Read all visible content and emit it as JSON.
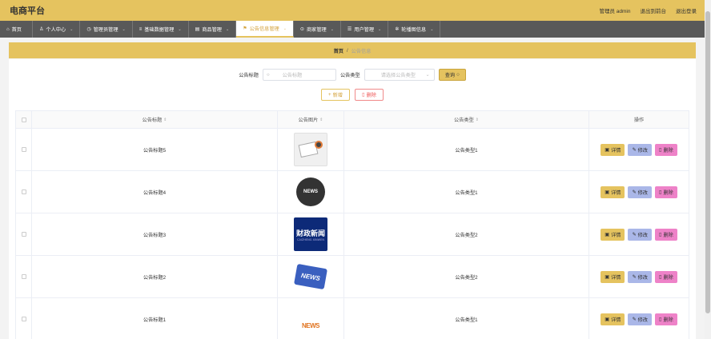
{
  "header": {
    "app_title": "电商平台",
    "user_label": "管理员 admin",
    "front_link": "退出到前台",
    "logout_link": "退出登录"
  },
  "nav": {
    "items": [
      {
        "label": "首页",
        "icon": "home-icon",
        "caret": ""
      },
      {
        "label": "个人中心",
        "icon": "user-icon",
        "caret": "⌄"
      },
      {
        "label": "管理员管理",
        "icon": "clock-icon",
        "caret": "⌄"
      },
      {
        "label": "基础数据管理",
        "icon": "list-icon",
        "caret": "⌄"
      },
      {
        "label": "商品管理",
        "icon": "chart-icon",
        "caret": "⌄"
      },
      {
        "label": "公告信息管理",
        "icon": "flag-icon",
        "caret": "⌄"
      },
      {
        "label": "商家管理",
        "icon": "pin-icon",
        "caret": "⌄"
      },
      {
        "label": "用户管理",
        "icon": "people-icon",
        "caret": "⌄"
      },
      {
        "label": "轮播图信息",
        "icon": "gear-icon",
        "caret": "⌄"
      }
    ],
    "active_index": 5
  },
  "breadcrumb": {
    "home": "首页",
    "sep": "/",
    "current": "公告信息"
  },
  "search": {
    "title_label": "公告标题",
    "title_placeholder": "公告标题",
    "type_label": "公告类型",
    "type_placeholder": "请选择公告类型",
    "query_button": "查询"
  },
  "actions": {
    "add_button": "新增",
    "delete_button": "删除"
  },
  "table": {
    "columns": {
      "title": "公告标题",
      "image": "公告图片",
      "type": "公告类型",
      "ops": "操作"
    },
    "rows": [
      {
        "title": "公告标题5",
        "type": "公告类型1",
        "image": "thumb1"
      },
      {
        "title": "公告标题4",
        "type": "公告类型1",
        "image": "thumb2"
      },
      {
        "title": "公告标题3",
        "type": "公告类型2",
        "image": "thumb3"
      },
      {
        "title": "公告标题2",
        "type": "公告类型2",
        "image": "thumb4"
      },
      {
        "title": "公告标题1",
        "type": "公告类型1",
        "image": "thumb5"
      }
    ],
    "op_labels": {
      "detail": "详情",
      "edit": "修改",
      "delete": "删除"
    }
  },
  "thumb_text": {
    "globe": "NEWS",
    "finance_big": "财政新闻",
    "finance_small": "CAIZHENG XINWEN",
    "sign": "NEWS",
    "word": "NEWS"
  },
  "colors": {
    "brand": "#e5c35f",
    "nav_bg": "#595959",
    "edit": "#aab7e8",
    "delete": "#ee82c8"
  }
}
